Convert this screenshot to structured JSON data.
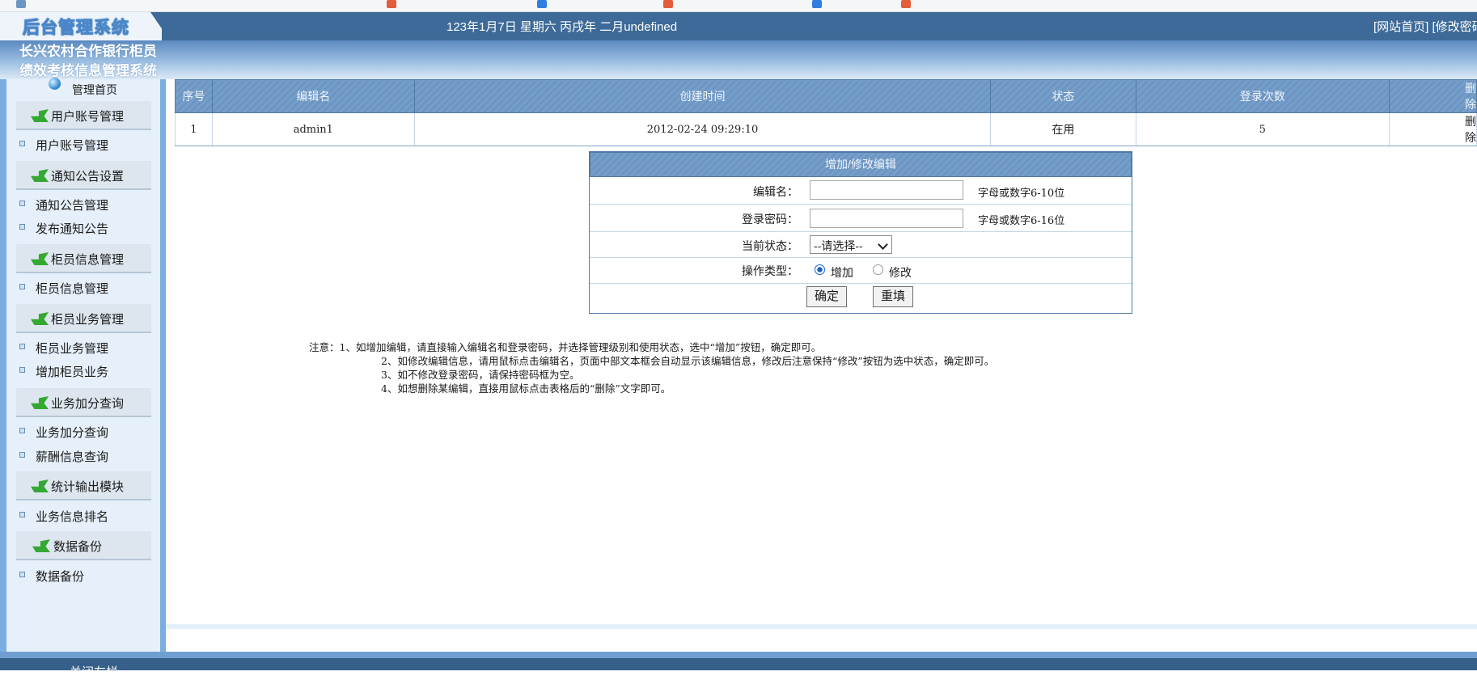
{
  "header": {
    "logo": "后台管理系统",
    "date": "123年1月7日 星期六 丙戌年 二月undefined",
    "links": [
      "[网站首页]",
      "[修改密码"
    ]
  },
  "bank_title": [
    "长兴农村合作银行柜员",
    "绩效考核信息管理系统"
  ],
  "sidebar": {
    "home": "管理首页",
    "sections": [
      {
        "label": "用户账号管理",
        "items": [
          "用户账号管理"
        ]
      },
      {
        "label": "通知公告设置",
        "items": [
          "通知公告管理",
          "发布通知公告"
        ]
      },
      {
        "label": "柜员信息管理",
        "items": [
          "柜员信息管理"
        ]
      },
      {
        "label": "柜员业务管理",
        "items": [
          "柜员业务管理",
          "增加柜员业务"
        ]
      },
      {
        "label": "业务加分查询",
        "items": [
          "业务加分查询",
          "薪酬信息查询"
        ]
      },
      {
        "label": "统计输出模块",
        "items": [
          "业务信息排名"
        ]
      },
      {
        "label": "数据备份",
        "items": [
          "数据备份"
        ]
      }
    ]
  },
  "table": {
    "headers": [
      "序号",
      "编辑名",
      "创建时间",
      "状态",
      "登录次数",
      "删除"
    ],
    "rows": [
      [
        "1",
        "admin1",
        "2012-02-24 09:29:10",
        "在用",
        "5",
        "删除"
      ]
    ]
  },
  "form": {
    "title": "增加/修改编辑",
    "name_label": "编辑名：",
    "name_value": "",
    "name_hint": "字母或数字6-10位",
    "pwd_label": "登录密码：",
    "pwd_value": "",
    "pwd_hint": "字母或数字6-16位",
    "status_label": "当前状态：",
    "status_selected": "--请选择--",
    "op_label": "操作类型：",
    "op_add": "增加",
    "op_edit": "修改",
    "op_selected": "增加",
    "confirm": "确定",
    "reset": "重填"
  },
  "notes": [
    "注意：1、如增加编辑，请直接输入编辑名和登录密码，并选择管理级别和使用状态，选中“增加”按钮，确定即可。",
    "2、如修改编辑信息，请用鼠标点击编辑名，页面中部文本框会自动显示该编辑信息，修改后注意保持“修改”按钮为选中状态，确定即可。",
    "3、如不修改登录密码，请保持密码框为空。",
    "4、如想删除某编辑，直接用鼠标点击表格后的“删除”文字即可。"
  ],
  "footer": "关闭左栏"
}
